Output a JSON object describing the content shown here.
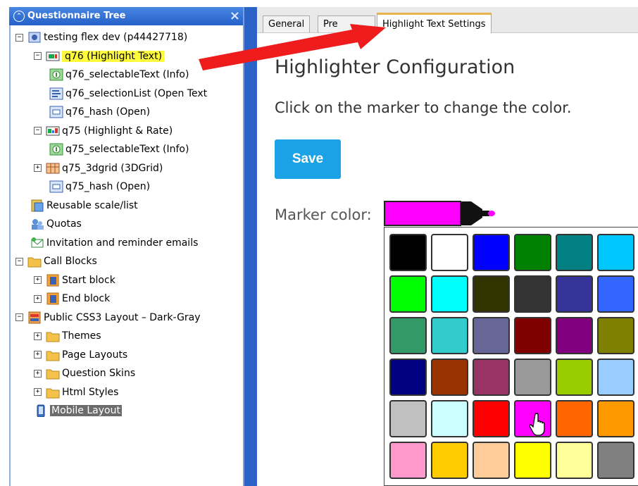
{
  "tree": {
    "title": "Questionnaire Tree",
    "nodes": [
      {
        "label": "testing flex dev (p44427718)",
        "expander": "−",
        "icon": "survey-icon",
        "indent": 0
      },
      {
        "label": "q76 (Highlight Text)",
        "expander": "−",
        "icon": "highlight-question-icon",
        "indent": 1,
        "highlighted": true
      },
      {
        "label": "q76_selectableText (Info)",
        "expander": "",
        "icon": "info-icon",
        "indent": 2
      },
      {
        "label": "q76_selectionList (Open Text",
        "expander": "",
        "icon": "open-text-icon",
        "indent": 2
      },
      {
        "label": "q76_hash (Open)",
        "expander": "",
        "icon": "open-icon",
        "indent": 2
      },
      {
        "label": "q75 (Highlight & Rate)",
        "expander": "−",
        "icon": "highlight-rate-icon",
        "indent": 1
      },
      {
        "label": "q75_selectableText (Info)",
        "expander": "",
        "icon": "info-icon",
        "indent": 2
      },
      {
        "label": "q75_3dgrid (3DGrid)",
        "expander": "+",
        "icon": "grid-icon",
        "indent": 1
      },
      {
        "label": "q75_hash (Open)",
        "expander": "",
        "icon": "open-icon",
        "indent": 2
      },
      {
        "label": "Reusable scale/list",
        "expander": "",
        "icon": "scale-list-icon",
        "indent": -1
      },
      {
        "label": "Quotas",
        "expander": "",
        "icon": "quotas-icon",
        "indent": -1
      },
      {
        "label": "Invitation and reminder emails",
        "expander": "",
        "icon": "email-icon",
        "indent": -1
      },
      {
        "label": "Call Blocks",
        "expander": "−",
        "icon": "folder-icon",
        "indent": 0
      },
      {
        "label": "Start block",
        "expander": "+",
        "icon": "block-icon",
        "indent": 1
      },
      {
        "label": "End block",
        "expander": "+",
        "icon": "block-icon",
        "indent": 1
      },
      {
        "label": "Public CSS3 Layout – Dark-Gray",
        "expander": "−",
        "icon": "layout-icon",
        "indent": 0
      },
      {
        "label": "Themes",
        "expander": "+",
        "icon": "folder-icon",
        "indent": 1
      },
      {
        "label": "Page Layouts",
        "expander": "+",
        "icon": "folder-icon",
        "indent": 1
      },
      {
        "label": "Question Skins",
        "expander": "+",
        "icon": "folder-icon",
        "indent": 1
      },
      {
        "label": "Html Styles",
        "expander": "+",
        "icon": "folder-icon",
        "indent": 1
      },
      {
        "label": "Mobile Layout",
        "expander": "",
        "icon": "mobile-icon",
        "indent": 1,
        "selected": true
      }
    ]
  },
  "tabs": [
    {
      "label": "General",
      "active": false
    },
    {
      "label": "Pre",
      "active": false
    },
    {
      "label": "Highlight Text Settings",
      "active": true
    }
  ],
  "main": {
    "title": "Highlighter Configuration",
    "instruction": "Click on the marker to change the color.",
    "save_label": "Save",
    "marker_label": "Marker color:",
    "marker_color": "#ff00ff"
  },
  "palette": {
    "colors": [
      [
        "#000000",
        "#ffffff",
        "#0000ff",
        "#008000",
        "#008080",
        "#00c8ff"
      ],
      [
        "#00ff00",
        "#00ffff",
        "#333300",
        "#333333",
        "#333399",
        "#3366ff"
      ],
      [
        "#339966",
        "#33cccc",
        "#666699",
        "#800000",
        "#800080",
        "#808000"
      ],
      [
        "#000080",
        "#993300",
        "#993366",
        "#999999",
        "#99cc00",
        "#99ccff"
      ],
      [
        "#c0c0c0",
        "#ccffff",
        "#ff0000",
        "#ff00ff",
        "#ff6600",
        "#ff9900"
      ],
      [
        "#ff99cc",
        "#ffcc00",
        "#ffcc99",
        "#ffff00",
        "#ffff99",
        "#808080"
      ]
    ],
    "hovered": [
      4,
      3
    ]
  },
  "annotation_arrow_color": "#ee1c1c"
}
